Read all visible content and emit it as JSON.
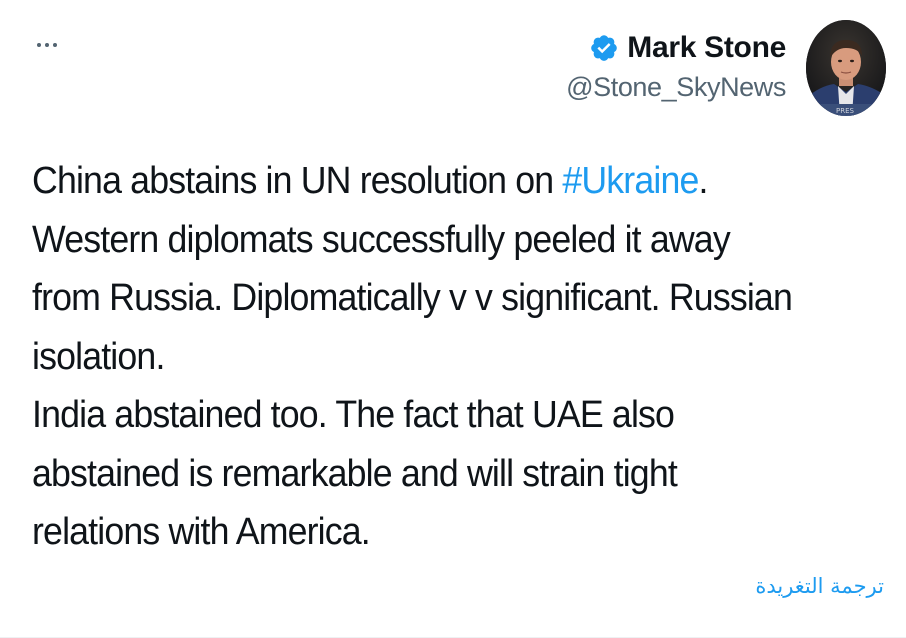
{
  "tweet": {
    "author": {
      "display_name": "Mark Stone",
      "handle": "@Stone_SkyNews",
      "verified": true
    },
    "menu_icon": "more-horizontal-icon",
    "text": {
      "line1_before": "China abstains in UN resolution on ",
      "hashtag": "#Ukraine",
      "line1_after": ".",
      "line2": "Western diplomats successfully peeled it away",
      "line3": "from Russia. Diplomatically v v significant. Russian",
      "line4": "isolation.",
      "line5": "India abstained too. The fact that UAE also",
      "line6": "abstained is remarkable and will strain tight",
      "line7": "relations with America."
    },
    "translate_label": "ترجمة التغريدة"
  },
  "colors": {
    "link": "#1d9bf0",
    "text": "#0f1419",
    "secondary": "#536471",
    "verified": "#1d9bf0"
  }
}
